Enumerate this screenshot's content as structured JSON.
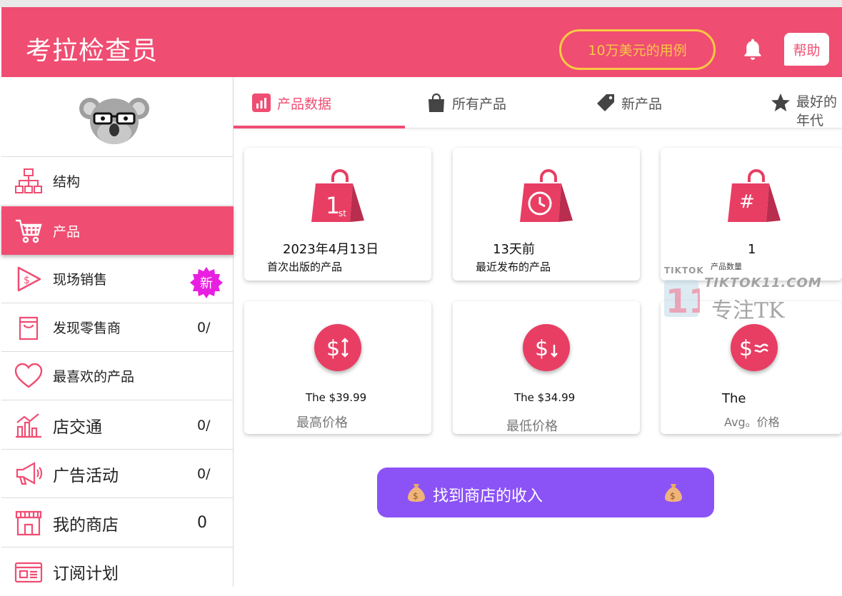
{
  "header": {
    "brand": "考拉检查员",
    "case_button": "10万美元的用例",
    "help_button": "帮助"
  },
  "sidebar": {
    "items": [
      {
        "label": "结构",
        "count": "",
        "icon": "sitemap-icon"
      },
      {
        "label": "产品",
        "count": "",
        "icon": "cart-icon",
        "active": true
      },
      {
        "label": "现场销售",
        "count": "",
        "icon": "play-dollar-icon",
        "badge": "新"
      },
      {
        "label": "发现零售商",
        "count": "0/",
        "icon": "shopping-bag-icon"
      },
      {
        "label": "最喜欢的产品",
        "count": "",
        "icon": "heart-icon"
      },
      {
        "label": "店交通",
        "count": "0/",
        "icon": "traffic-chart-icon"
      },
      {
        "label": "广告活动",
        "count": "0/",
        "icon": "megaphone-icon"
      },
      {
        "label": "我的商店",
        "count": "0",
        "icon": "storefront-icon"
      },
      {
        "label": "订阅计划",
        "count": "",
        "icon": "subscription-icon"
      }
    ]
  },
  "tabs": [
    {
      "label": "产品数据",
      "icon": "bar-chart-icon",
      "active": true
    },
    {
      "label": "所有产品",
      "icon": "bag-icon"
    },
    {
      "label": "新产品",
      "icon": "tag-icon"
    },
    {
      "label": "最好的年代",
      "icon": "star-icon"
    }
  ],
  "tab4_line1": "最好的",
  "tab4_line2": "年代",
  "cards": {
    "first_release": {
      "value": "2023年4月13日",
      "label": "首次出版的产品",
      "bag_text": "1",
      "bag_sup": "st"
    },
    "recent_release": {
      "value": "13天前",
      "label": "最近发布的产品"
    },
    "product_count": {
      "value": "1",
      "label": "产品数量",
      "bag_text": "#"
    },
    "max_price": {
      "value": "The $39.99",
      "label": "最高价格",
      "coin": "$↕"
    },
    "min_price": {
      "value": "The $34.99",
      "label": "最低价格",
      "coin": "$↓"
    },
    "avg_price": {
      "value": "The",
      "label": "Avg。价格",
      "coin": "$≈"
    }
  },
  "watermark": {
    "top": "TIKTOK",
    "site": "TIKTOK11.COM",
    "name": "专注TK",
    "logo": "11"
  },
  "cta": {
    "label": "找到商店的收入"
  },
  "colors": {
    "brand": "#f04d72",
    "accent_yellow": "#f7c944",
    "cta_purple": "#8b53f6",
    "badge_magenta": "#e81fe0"
  }
}
